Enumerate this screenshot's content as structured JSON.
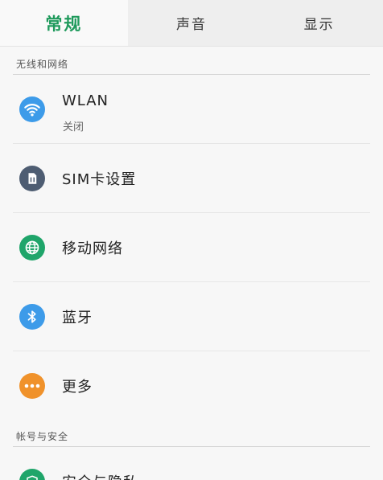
{
  "tabs": [
    {
      "label": "常规",
      "active": true
    },
    {
      "label": "声音",
      "active": false
    },
    {
      "label": "显示",
      "active": false
    }
  ],
  "sections": [
    {
      "title": "无线和网络",
      "items": [
        {
          "label": "WLAN",
          "sublabel": "关闭",
          "icon": "wifi-icon",
          "color": "#3d9be9"
        },
        {
          "label": "SIM卡设置",
          "icon": "sim-card-icon",
          "color": "#4e5d72"
        },
        {
          "label": "移动网络",
          "icon": "globe-icon",
          "color": "#1fa56a"
        },
        {
          "label": "蓝牙",
          "icon": "bluetooth-icon",
          "color": "#3d9be9"
        },
        {
          "label": "更多",
          "icon": "more-icon",
          "color": "#f0922b"
        }
      ]
    },
    {
      "title": "帐号与安全",
      "items": [
        {
          "label": "安全与隐私",
          "icon": "shield-icon",
          "color": "#1fa56a"
        }
      ]
    }
  ],
  "accent_color": "#1f9a5c"
}
